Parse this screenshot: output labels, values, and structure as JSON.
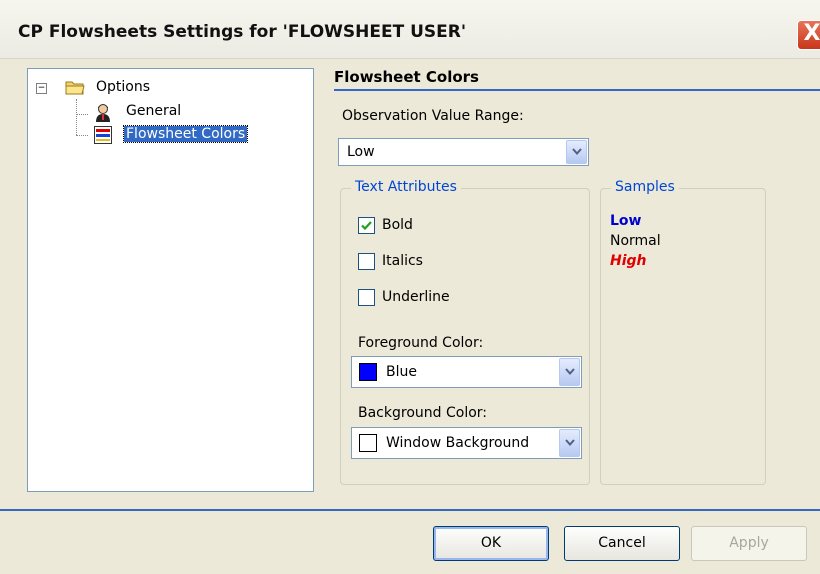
{
  "window": {
    "title": "CP Flowsheets Settings for 'FLOWSHEET USER'",
    "close_glyph": "X"
  },
  "tree": {
    "expander_glyph": "−",
    "items": [
      {
        "label": "Options",
        "icon": "folder-icon"
      },
      {
        "label": "General",
        "icon": "person-icon"
      },
      {
        "label": "Flowsheet Colors",
        "icon": "color-bars-icon",
        "selected": true
      }
    ]
  },
  "panel": {
    "title": "Flowsheet Colors",
    "range_label": "Observation Value Range:",
    "range_value": "Low",
    "text_attributes": {
      "legend": "Text Attributes",
      "bold": {
        "label": "Bold",
        "checked": true
      },
      "italics": {
        "label": "Italics",
        "checked": false
      },
      "underline": {
        "label": "Underline",
        "checked": false
      },
      "fg_label": "Foreground Color:",
      "fg_value": "Blue",
      "fg_swatch": "#0000ff",
      "bg_label": "Background Color:",
      "bg_value": "Window Background",
      "bg_swatch": "#ffffff"
    },
    "samples": {
      "legend": "Samples",
      "low": {
        "text": "Low",
        "color": "#0000cc"
      },
      "normal": {
        "text": "Normal",
        "color": "#000000"
      },
      "high": {
        "text": "High",
        "color": "#e00000"
      }
    }
  },
  "buttons": {
    "ok": "OK",
    "cancel": "Cancel",
    "apply": "Apply"
  }
}
